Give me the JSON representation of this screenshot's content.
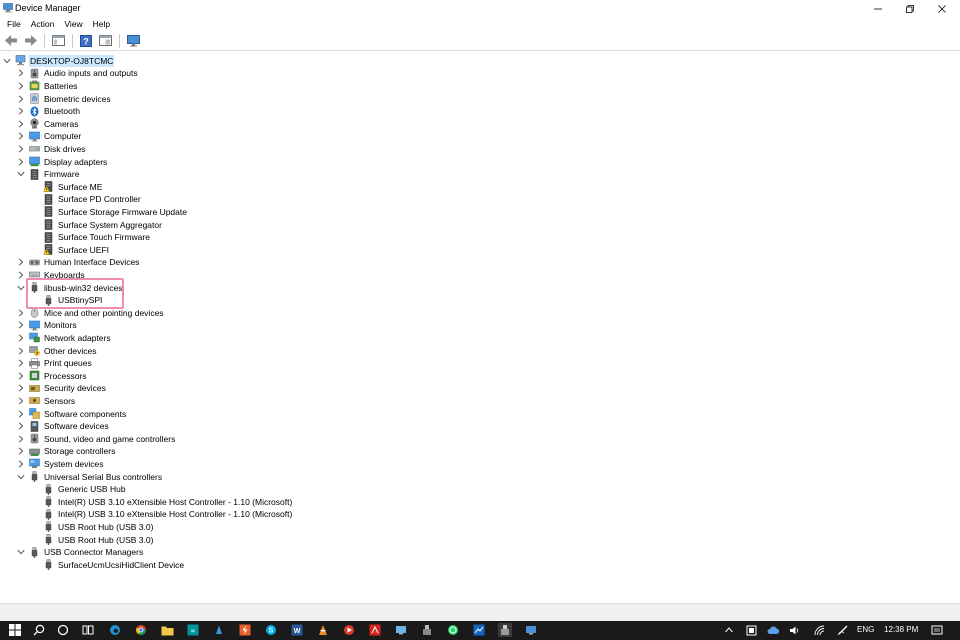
{
  "window": {
    "title": "Device Manager"
  },
  "menu": [
    "File",
    "Action",
    "View",
    "Help"
  ],
  "tree": [
    {
      "label": "DESKTOP-OJ8TCMC",
      "level": 0,
      "state": "expanded",
      "icon": "computer-root-icon"
    },
    {
      "label": "Audio inputs and outputs",
      "level": 1,
      "state": "collapsed",
      "icon": "speaker-icon"
    },
    {
      "label": "Batteries",
      "level": 1,
      "state": "collapsed",
      "icon": "battery-icon"
    },
    {
      "label": "Biometric devices",
      "level": 1,
      "state": "collapsed",
      "icon": "fingerprint-icon"
    },
    {
      "label": "Bluetooth",
      "level": 1,
      "state": "collapsed",
      "icon": "bluetooth-icon"
    },
    {
      "label": "Cameras",
      "level": 1,
      "state": "collapsed",
      "icon": "camera-icon"
    },
    {
      "label": "Computer",
      "level": 1,
      "state": "collapsed",
      "icon": "monitor-icon"
    },
    {
      "label": "Disk drives",
      "level": 1,
      "state": "collapsed",
      "icon": "disk-drive-icon"
    },
    {
      "label": "Display adapters",
      "level": 1,
      "state": "collapsed",
      "icon": "display-adapter-icon"
    },
    {
      "label": "Firmware",
      "level": 1,
      "state": "expanded",
      "icon": "firmware-icon"
    },
    {
      "label": "Surface ME",
      "level": 2,
      "state": "none",
      "icon": "firmware-warning-icon"
    },
    {
      "label": "Surface PD Controller",
      "level": 2,
      "state": "none",
      "icon": "firmware-chip-icon"
    },
    {
      "label": "Surface Storage Firmware Update",
      "level": 2,
      "state": "none",
      "icon": "firmware-chip-icon"
    },
    {
      "label": "Surface System Aggregator",
      "level": 2,
      "state": "none",
      "icon": "firmware-chip-icon"
    },
    {
      "label": "Surface Touch Firmware",
      "level": 2,
      "state": "none",
      "icon": "firmware-chip-icon"
    },
    {
      "label": "Surface UEFI",
      "level": 2,
      "state": "none",
      "icon": "firmware-warning-icon"
    },
    {
      "label": "Human Interface Devices",
      "level": 1,
      "state": "collapsed",
      "icon": "hid-icon"
    },
    {
      "label": "Keyboards",
      "level": 1,
      "state": "collapsed",
      "icon": "keyboard-icon"
    },
    {
      "label": "libusb-win32 devices",
      "level": 1,
      "state": "expanded",
      "icon": "usb-plug-icon"
    },
    {
      "label": "USBtinySPI",
      "level": 2,
      "state": "none",
      "icon": "usb-plug-icon"
    },
    {
      "label": "Mice and other pointing devices",
      "level": 1,
      "state": "collapsed",
      "icon": "mouse-icon"
    },
    {
      "label": "Monitors",
      "level": 1,
      "state": "collapsed",
      "icon": "monitor-icon"
    },
    {
      "label": "Network adapters",
      "level": 1,
      "state": "collapsed",
      "icon": "network-adapter-icon"
    },
    {
      "label": "Other devices",
      "level": 1,
      "state": "collapsed",
      "icon": "other-devices-icon"
    },
    {
      "label": "Print queues",
      "level": 1,
      "state": "collapsed",
      "icon": "printer-icon"
    },
    {
      "label": "Processors",
      "level": 1,
      "state": "collapsed",
      "icon": "processor-icon"
    },
    {
      "label": "Security devices",
      "level": 1,
      "state": "collapsed",
      "icon": "security-device-icon"
    },
    {
      "label": "Sensors",
      "level": 1,
      "state": "collapsed",
      "icon": "sensor-icon"
    },
    {
      "label": "Software components",
      "level": 1,
      "state": "collapsed",
      "icon": "software-component-icon"
    },
    {
      "label": "Software devices",
      "level": 1,
      "state": "collapsed",
      "icon": "software-device-icon"
    },
    {
      "label": "Sound, video and game controllers",
      "level": 1,
      "state": "collapsed",
      "icon": "speaker-icon"
    },
    {
      "label": "Storage controllers",
      "level": 1,
      "state": "collapsed",
      "icon": "storage-controller-icon"
    },
    {
      "label": "System devices",
      "level": 1,
      "state": "collapsed",
      "icon": "system-device-icon"
    },
    {
      "label": "Universal Serial Bus controllers",
      "level": 1,
      "state": "expanded",
      "icon": "usb-plug-icon"
    },
    {
      "label": "Generic USB Hub",
      "level": 2,
      "state": "none",
      "icon": "usb-plug-icon"
    },
    {
      "label": "Intel(R) USB 3.10 eXtensible Host Controller - 1.10 (Microsoft)",
      "level": 2,
      "state": "none",
      "icon": "usb-plug-icon"
    },
    {
      "label": "Intel(R) USB 3.10 eXtensible Host Controller - 1.10 (Microsoft)",
      "level": 2,
      "state": "none",
      "icon": "usb-plug-icon"
    },
    {
      "label": "USB Root Hub (USB 3.0)",
      "level": 2,
      "state": "none",
      "icon": "usb-plug-icon"
    },
    {
      "label": "USB Root Hub (USB 3.0)",
      "level": 2,
      "state": "none",
      "icon": "usb-plug-icon"
    },
    {
      "label": "USB Connector Managers",
      "level": 1,
      "state": "expanded",
      "icon": "usb-plug-icon"
    },
    {
      "label": "SurfaceUcmUcsiHidClient Device",
      "level": 2,
      "state": "none",
      "icon": "usb-plug-icon"
    }
  ],
  "taskbar": {
    "language": "ENG",
    "time": "12:38 PM"
  },
  "colors": {
    "selection": "#cce8ff",
    "highlight_box": "#f08cb4",
    "taskbar": "#1a1a1a"
  }
}
